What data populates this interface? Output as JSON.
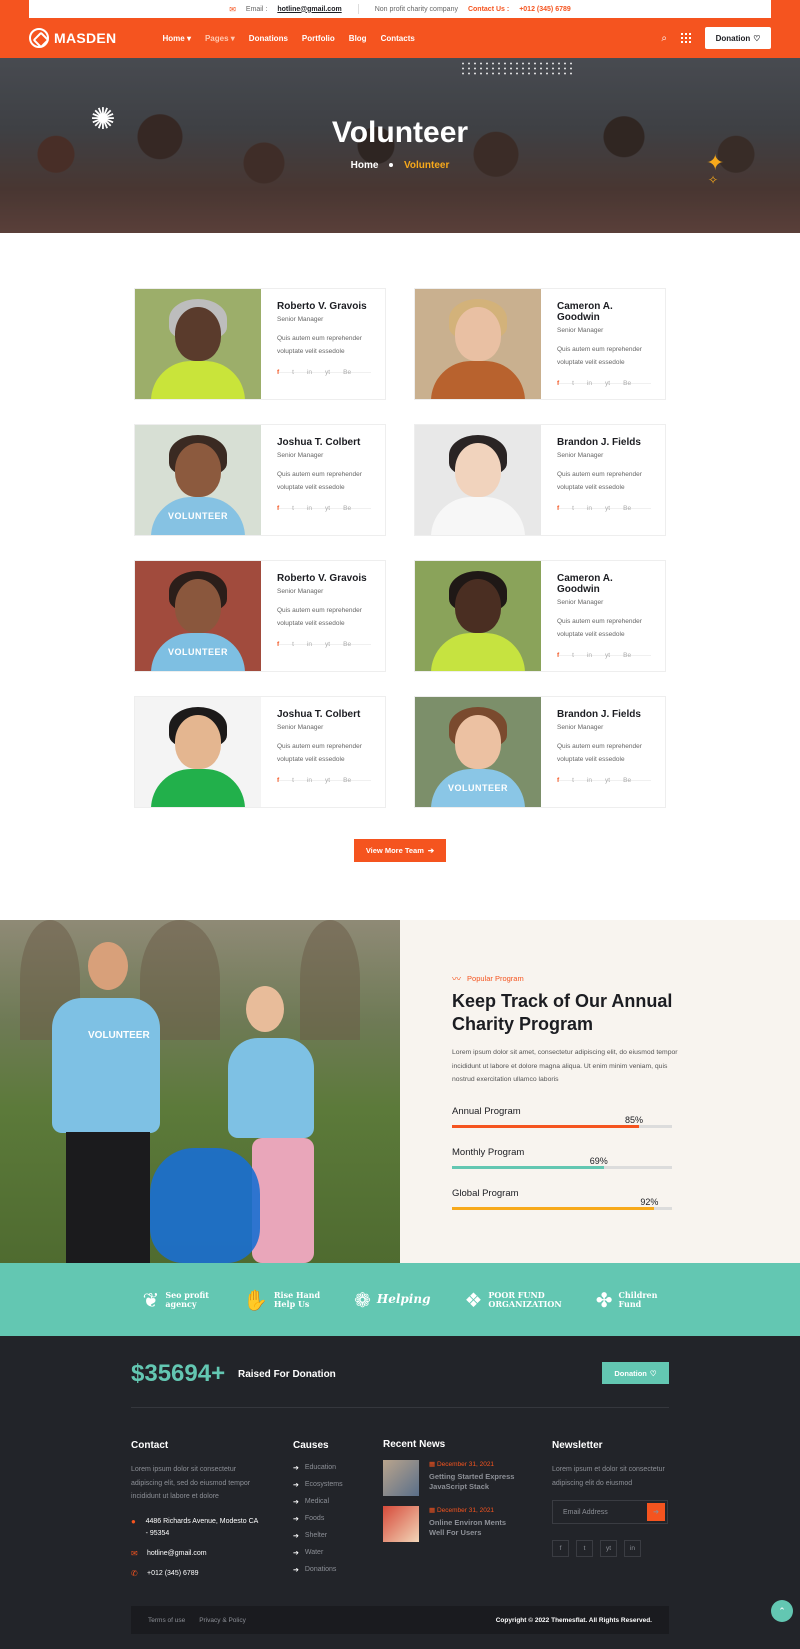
{
  "topbar": {
    "email_label": "Email :",
    "email_value": "hotline@gmail.com",
    "tagline": "Non profit charity company",
    "contact_label": "Contact Us :",
    "contact_phone": "+012 (345) 6789"
  },
  "nav": {
    "logo": "MASDEN",
    "menu": [
      "Home",
      "Pages",
      "Donations",
      "Portfolio",
      "Blog",
      "Contacts"
    ],
    "donation_label": "Donation"
  },
  "hero": {
    "title": "Volunteer",
    "crumb_home": "Home",
    "crumb_current": "Volunteer"
  },
  "volunteers": [
    {
      "name": "Roberto V. Gravois",
      "role": "Senior Manager",
      "desc": "Quis autem eum reprehender voluptate velit essedole",
      "skin": "#5a3b2c",
      "hair": "#bdbdbd",
      "shirt": "#c9e43a",
      "bg": "#9cae6a"
    },
    {
      "name": "Cameron A. Goodwin",
      "role": "Senior Manager",
      "desc": "Quis autem eum reprehender voluptate velit essedole",
      "skin": "#e9c0a3",
      "hair": "#d3b27a",
      "shirt": "#b8622e",
      "bg": "#c9b08f"
    },
    {
      "name": "Joshua T. Colbert",
      "role": "Senior Manager",
      "desc": "Quis autem eum reprehender voluptate velit essedole",
      "skin": "#8c5a3e",
      "hair": "#3a2a22",
      "shirt": "#86c2e3",
      "bg": "#d7dfd4"
    },
    {
      "name": "Brandon J. Fields",
      "role": "Senior Manager",
      "desc": "Quis autem eum reprehender voluptate velit essedole",
      "skin": "#f1d3bd",
      "hair": "#2a2424",
      "shirt": "#f7f7f7",
      "bg": "#e8e8e8"
    },
    {
      "name": "Roberto V. Gravois",
      "role": "Senior Manager",
      "desc": "Quis autem eum reprehender voluptate velit essedole",
      "skin": "#8a573d",
      "hair": "#2b1e1a",
      "shirt": "#7ebfe2",
      "bg": "#a14b3d"
    },
    {
      "name": "Cameron A. Goodwin",
      "role": "Senior Manager",
      "desc": "Quis autem eum reprehender voluptate velit essedole",
      "skin": "#4a2e22",
      "hair": "#1f1816",
      "shirt": "#c6e340",
      "bg": "#8aa35a"
    },
    {
      "name": "Joshua T. Colbert",
      "role": "Senior Manager",
      "desc": "Quis autem eum reprehender voluptate velit essedole",
      "skin": "#e4b690",
      "hair": "#1c1a1a",
      "shirt": "#22b04b",
      "bg": "#f4f4f4"
    },
    {
      "name": "Brandon J. Fields",
      "role": "Senior Manager",
      "desc": "Quis autem eum reprehender voluptate velit essedole",
      "skin": "#ecc1a2",
      "hair": "#7a4a2e",
      "shirt": "#8ac6e6",
      "bg": "#7c8f6a"
    }
  ],
  "volunteer_shirt_text": "VOLUNTEER",
  "social": [
    "f",
    "t",
    "in",
    "yt",
    "Be"
  ],
  "view_more_label": "View More Team",
  "program": {
    "tag": "Popular Program",
    "title": "Keep Track of Our Annual Charity Program",
    "text": "Lorem ipsum dolor sit amet, consectetur adipiscing elit, do eiusmod tempor incididunt ut labore et dolore magna aliqua. Ut enim minim veniam, quis nostrud exercitation ullamco laboris",
    "bars": [
      {
        "label": "Annual Program",
        "percent": 85,
        "percent_label": "85%",
        "color": "#f5541f"
      },
      {
        "label": "Monthly Program",
        "percent": 69,
        "percent_label": "69%",
        "color": "#63c7b2"
      },
      {
        "label": "Global Program",
        "percent": 92,
        "percent_label": "92%",
        "color": "#f7a91b"
      }
    ]
  },
  "partners": [
    {
      "line1": "Seo profit",
      "line2": "agency",
      "icon": "❦"
    },
    {
      "line1": "Rise Hand",
      "line2": "Help Us",
      "icon": "✋"
    },
    {
      "line1": "Helping",
      "line2": "",
      "icon": "❁"
    },
    {
      "line1": "POOR FUND",
      "line2": "ORGANIZATION",
      "icon": "❖"
    },
    {
      "line1": "Children",
      "line2": "Fund",
      "icon": "✤"
    }
  ],
  "footer": {
    "raised_amount": "$35694+",
    "raised_label": "Raised For Donation",
    "donation_label": "Donation",
    "contact_head": "Contact",
    "contact_text": "Lorem ipsum dolor sit consectetur adipiscing elit, sed do eiusmod tempor incididunt ut labore et dolore",
    "address": "4486 Richards Avenue, Modesto CA - 95354",
    "email": "hotline@gmail.com",
    "phone": "+012 (345) 6789",
    "causes_head": "Causes",
    "causes": [
      "Education",
      "Ecosystems",
      "Medical",
      "Foods",
      "Shelter",
      "Water",
      "Donations"
    ],
    "news_head": "Recent News",
    "news": [
      {
        "date": "December 31, 2021",
        "title": "Getting Started Express JavaScript Stack"
      },
      {
        "date": "December 31, 2021",
        "title": "Online Environ Ments Well For Users"
      }
    ],
    "newsletter_head": "Newsletter",
    "newsletter_text": "Lorem ipsum et dolor sit consectetur adipiscing elit do eiusmod",
    "email_placeholder": "Email Address",
    "social": [
      "f",
      "t",
      "yt",
      "in"
    ],
    "terms": "Terms of use",
    "privacy": "Privacy & Policy",
    "copyright": "Copyright © 2022 Themesflat. All Rights Reserved."
  },
  "colors": {
    "accent": "#f5541f",
    "teal": "#63c7b2",
    "yellow": "#f7a91b",
    "dark": "#222429"
  }
}
